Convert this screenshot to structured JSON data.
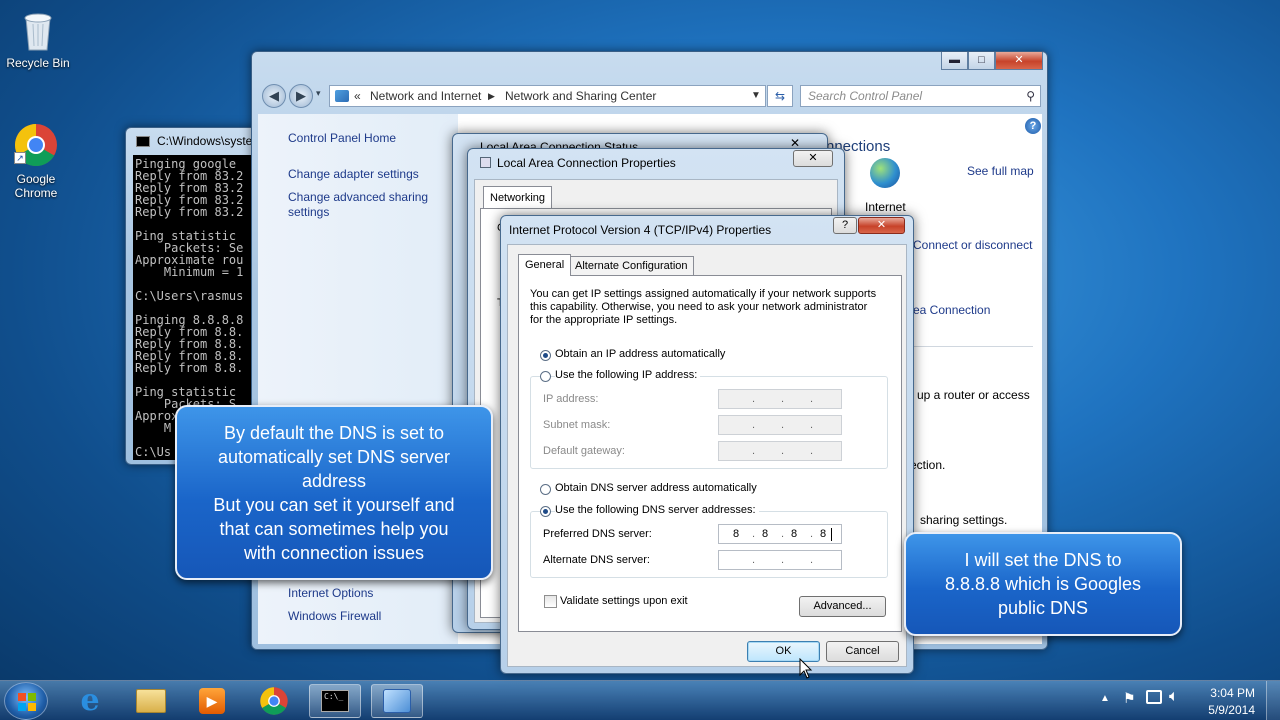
{
  "desktop": {
    "icons": [
      {
        "label": "Recycle Bin",
        "icon": "recycle-bin-icon"
      },
      {
        "label": "Google Chrome",
        "icon": "chrome-icon"
      }
    ]
  },
  "console": {
    "title": "C:\\Windows\\syste",
    "lines": [
      "Pinging google",
      "Reply from 83.2",
      "Reply from 83.2",
      "Reply from 83.2",
      "Reply from 83.2",
      "",
      "Ping statistic",
      "    Packets: Se",
      "Approximate rou",
      "    Minimum = 1",
      "",
      "C:\\Users\\rasmus",
      "",
      "Pinging 8.8.8.8",
      "Reply from 8.8.",
      "Reply from 8.8.",
      "Reply from 8.8.",
      "Reply from 8.8.",
      "",
      "Ping statistic",
      "    Packets: S",
      "Approx",
      "    M",
      "",
      "C:\\Us"
    ]
  },
  "control_panel": {
    "breadcrumb": [
      "Network and Internet",
      "Network and Sharing Center"
    ],
    "search_placeholder": "Search Control Panel",
    "chevrons": "«",
    "help": "?",
    "sidebar": {
      "home": "Control Panel Home",
      "items": [
        "Change adapter settings",
        "Change advanced sharing settings"
      ],
      "see_also": [
        "Internet Options",
        "Windows Firewall"
      ]
    },
    "main": {
      "heading": "nnections",
      "see_full_map": "See full map",
      "internet_label": "Internet",
      "connect": "Connect or disconnect",
      "area_connection": "rea Connection",
      "router": "up a router or access",
      "ection": "ection.",
      "sharing": "sharing settings."
    }
  },
  "status_window": {
    "title": "Local Area Connection Status"
  },
  "props_window": {
    "title": "Local Area Connection Properties",
    "tab": "Networking",
    "fragments": [
      "C",
      "T"
    ]
  },
  "ipv4": {
    "title": "Internet Protocol Version 4 (TCP/IPv4) Properties",
    "help": "?",
    "tabs": [
      "General",
      "Alternate Configuration"
    ],
    "description": "You can get IP settings assigned automatically if your network supports this capability. Otherwise, you need to ask your network administrator for the appropriate IP settings.",
    "obtain_ip_auto": "Obtain an IP address automatically",
    "use_following_ip": "Use the following IP address:",
    "ip_address_label": "IP address:",
    "subnet_label": "Subnet mask:",
    "gateway_label": "Default gateway:",
    "obtain_dns_auto": "Obtain DNS server address automatically",
    "use_following_dns": "Use the following DNS server addresses:",
    "preferred_dns_label": "Preferred DNS server:",
    "preferred_dns": [
      "8",
      "8",
      "8",
      "8"
    ],
    "alternate_dns_label": "Alternate DNS server:",
    "validate": "Validate settings upon exit",
    "advanced": "Advanced...",
    "ok": "OK",
    "cancel": "Cancel"
  },
  "callouts": {
    "left": [
      "By default the DNS is set to",
      "automatically set DNS server",
      "address",
      "But you can set it yourself and",
      "that can sometimes help you",
      "with connection issues"
    ],
    "right": [
      "I will set the DNS to",
      "8.8.8.8 which is Googles",
      "public DNS"
    ]
  },
  "taskbar": {
    "time": "3:04 PM",
    "date": "5/9/2014",
    "buttons": [
      "start",
      "internet-explorer",
      "explorer",
      "media-player",
      "chrome",
      "cmd",
      "control-panel"
    ]
  },
  "colors": {
    "accent": "#1a65c9",
    "link": "#1e3a8a"
  }
}
